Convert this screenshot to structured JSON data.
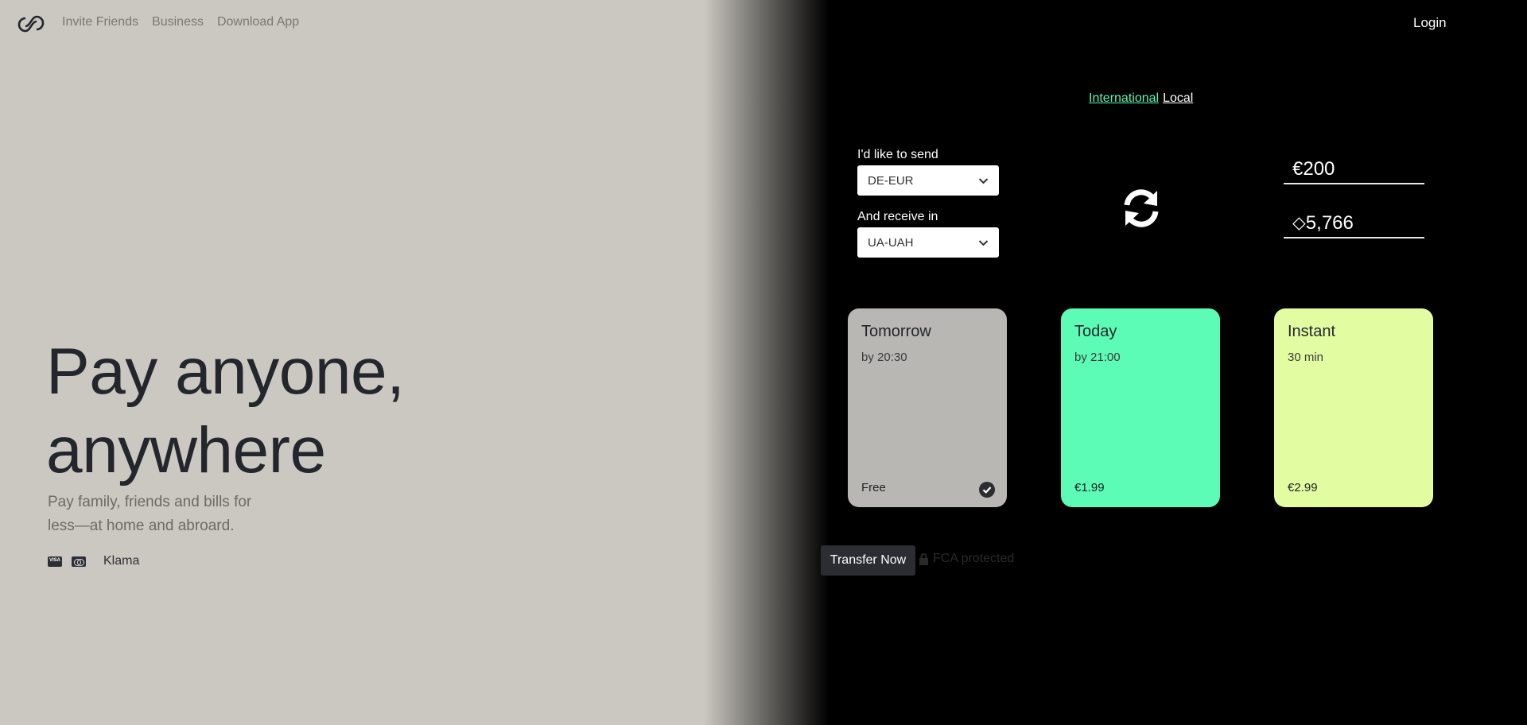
{
  "nav": {
    "links": [
      "Invite Friends",
      "Business",
      "Download App"
    ],
    "login": "Login"
  },
  "hero": {
    "title_line1": "Pay anyone,",
    "title_line2": "anywhere",
    "subtitle": "Pay family, friends and bills for less—at home and abroard.",
    "payment_brand": "Klama"
  },
  "widget": {
    "tabs": {
      "international": "International",
      "local": "Local",
      "active": "international"
    },
    "send_label": "I'd like to send",
    "send_currency": "DE-EUR",
    "receive_label": "And receive in",
    "receive_currency": "UA-UAH",
    "send_amount": "€200",
    "receive_amount": "⬦5,766",
    "options": [
      {
        "title": "Tomorrow",
        "eta": "by 20:30",
        "price": "Free",
        "selected": true,
        "color": "#b9b7b3"
      },
      {
        "title": "Today",
        "eta": "by 21:00",
        "price": "€1.99",
        "selected": false,
        "color": "#5cfcb7"
      },
      {
        "title": "Instant",
        "eta": "30 min",
        "price": "€2.99",
        "selected": false,
        "color": "#e2fca2"
      }
    ],
    "transfer_button": "Transfer Now",
    "fca_text": "FCA protected"
  },
  "colors": {
    "accent": "#5cf5b4",
    "left_bg": "#cbc8c1",
    "right_bg": "#000000"
  }
}
